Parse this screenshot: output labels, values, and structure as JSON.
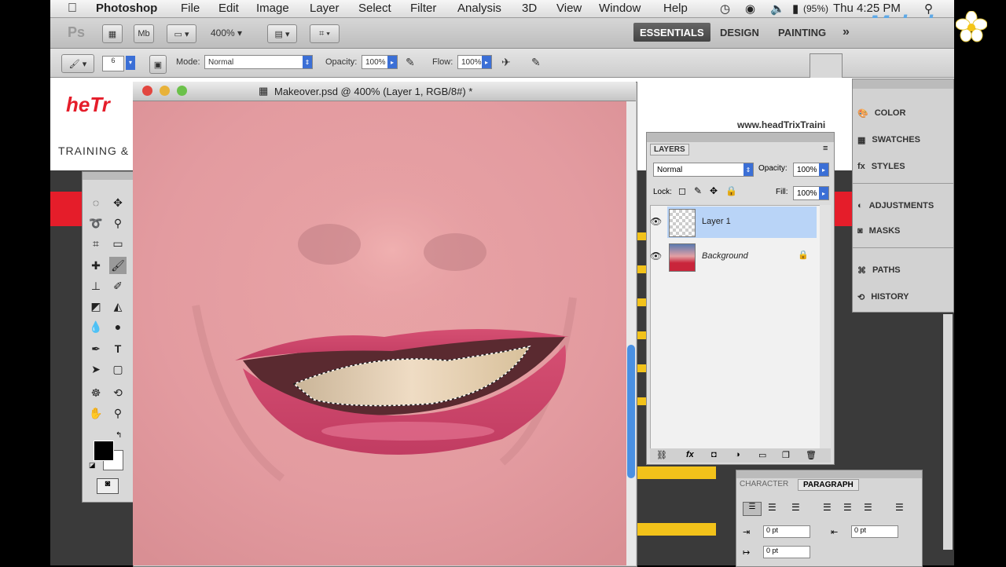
{
  "menubar": {
    "apple": "",
    "items": [
      "Photoshop",
      "File",
      "Edit",
      "Image",
      "Layer",
      "Select",
      "Filter",
      "Analysis",
      "3D",
      "View",
      "Window",
      "Help"
    ],
    "battery": "(95%)",
    "clock": "Thu 4:25 PM"
  },
  "appbar": {
    "ps_logo": "Ps",
    "zoom": "400%",
    "workspaces": [
      "ESSENTIALS",
      "DESIGN",
      "PAINTING"
    ],
    "more": "»"
  },
  "options": {
    "brush_size": "6",
    "mode_label": "Mode:",
    "mode_value": "Normal",
    "opacity_label": "Opacity:",
    "opacity_value": "100%",
    "flow_label": "Flow:",
    "flow_value": "100%"
  },
  "watermark": "Mahalo",
  "website": {
    "logo_text": "heTr",
    "tagline": "TRAINING & CO",
    "url": "www.headTrixTraini"
  },
  "document": {
    "title": "Makeover.psd @ 400% (Layer 1, RGB/8#) *"
  },
  "layers_panel": {
    "tab": "LAYERS",
    "blend_mode": "Normal",
    "opacity_label": "Opacity:",
    "opacity_value": "100%",
    "lock_label": "Lock:",
    "fill_label": "Fill:",
    "fill_value": "100%",
    "layers": [
      {
        "name": "Layer 1",
        "selected": true
      },
      {
        "name": "Background",
        "selected": false
      }
    ]
  },
  "dock": {
    "items": [
      "COLOR",
      "SWATCHES",
      "STYLES",
      "ADJUSTMENTS",
      "MASKS",
      "PATHS",
      "HISTORY"
    ]
  },
  "char_panel": {
    "tabs": [
      "CHARACTER",
      "PARAGRAPH"
    ],
    "fields": [
      "0 pt",
      "0 pt",
      "0 pt"
    ]
  },
  "colors": {
    "accent": "#3b6fd6",
    "selected_layer": "#b9d4f7",
    "site_red": "#e51d2a",
    "site_yellow": "#f2c21a"
  }
}
